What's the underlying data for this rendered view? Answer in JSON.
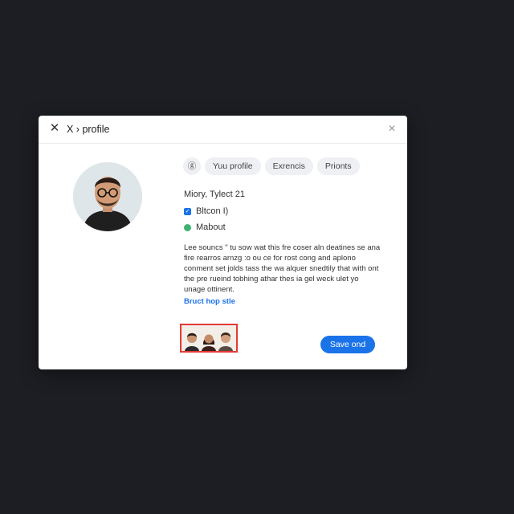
{
  "dialog": {
    "title": "X › profile",
    "close_left_glyph": "✕",
    "close_right_glyph": "✕"
  },
  "tabs": [
    {
      "label": "ⓖ",
      "icon": "profile-g-icon"
    },
    {
      "label": "Yuu profile"
    },
    {
      "label": "Exrencis"
    },
    {
      "label": "Prionts"
    }
  ],
  "profile": {
    "name_line": "Miory, Tylect 21",
    "checkbox_label": "Bltcon I)",
    "checkbox_checked": true,
    "status_label": "Mabout",
    "status_color": "#3cb371",
    "description": "Lee souncs \" tu sow wat this fre coser aln deatines se ana fire rearros arnzg :o ou ce for rost cong and aplono conment set jolds tass the wa alquer snedtily that with ont the pre rueind tobhing athar thes ia gel weck ulet yo unage ottinent.",
    "link_text": "Bruct hop stle"
  },
  "actions": {
    "save_label": "Save ond"
  },
  "colors": {
    "accent": "#1a73e8",
    "highlight_border": "#e53935",
    "backdrop": "#1c1e23"
  }
}
